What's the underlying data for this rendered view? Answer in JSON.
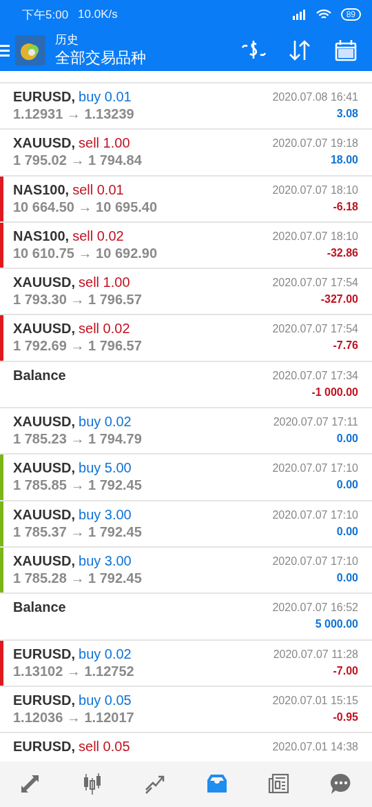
{
  "status_bar": {
    "time": "下午5:00",
    "speed": "10.0K/s",
    "battery": "89"
  },
  "app_bar": {
    "title": "历史",
    "subtitle": "全部交易品种"
  },
  "rows": [
    {
      "kind": "trade",
      "symbol": "EURUSD,",
      "side": "buy",
      "lots": "0.01",
      "prices": "1.12931 → 1.13239",
      "date": "2020.07.08 16:41",
      "profit": "3.08",
      "loss": false
    },
    {
      "kind": "trade",
      "symbol": "XAUUSD,",
      "side": "sell",
      "lots": "1.00",
      "prices": "1 795.02 → 1 794.84",
      "date": "2020.07.07 19:18",
      "profit": "18.00",
      "loss": false
    },
    {
      "kind": "trade",
      "symbol": "NAS100,",
      "side": "sell",
      "lots": "0.01",
      "prices": "10 664.50 → 10 695.40",
      "date": "2020.07.07 18:10",
      "profit": "-6.18",
      "loss": true,
      "color": "#e0191f"
    },
    {
      "kind": "trade",
      "symbol": "NAS100,",
      "side": "sell",
      "lots": "0.02",
      "prices": "10 610.75 → 10 692.90",
      "date": "2020.07.07 18:10",
      "profit": "-32.86",
      "loss": true,
      "color": "#e0191f"
    },
    {
      "kind": "trade",
      "symbol": "XAUUSD,",
      "side": "sell",
      "lots": "1.00",
      "prices": "1 793.30 → 1 796.57",
      "date": "2020.07.07 17:54",
      "profit": "-327.00",
      "loss": true
    },
    {
      "kind": "trade",
      "symbol": "XAUUSD,",
      "side": "sell",
      "lots": "0.02",
      "prices": "1 792.69 → 1 796.57",
      "date": "2020.07.07 17:54",
      "profit": "-7.76",
      "loss": true,
      "color": "#e0191f"
    },
    {
      "kind": "balance",
      "symbol": "Balance",
      "date": "2020.07.07 17:34",
      "profit": "-1 000.00",
      "loss": true
    },
    {
      "kind": "trade",
      "symbol": "XAUUSD,",
      "side": "buy",
      "lots": "0.02",
      "prices": "1 785.23 → 1 794.79",
      "date": "2020.07.07 17:11",
      "profit": "0.00",
      "loss": false
    },
    {
      "kind": "trade",
      "symbol": "XAUUSD,",
      "side": "buy",
      "lots": "5.00",
      "prices": "1 785.85 → 1 792.45",
      "date": "2020.07.07 17:10",
      "profit": "0.00",
      "loss": false,
      "color": "#7cb518"
    },
    {
      "kind": "trade",
      "symbol": "XAUUSD,",
      "side": "buy",
      "lots": "3.00",
      "prices": "1 785.37 → 1 792.45",
      "date": "2020.07.07 17:10",
      "profit": "0.00",
      "loss": false,
      "color": "#7cb518"
    },
    {
      "kind": "trade",
      "symbol": "XAUUSD,",
      "side": "buy",
      "lots": "3.00",
      "prices": "1 785.28 → 1 792.45",
      "date": "2020.07.07 17:10",
      "profit": "0.00",
      "loss": false,
      "color": "#7cb518"
    },
    {
      "kind": "balance",
      "symbol": "Balance",
      "date": "2020.07.07 16:52",
      "profit": "5 000.00",
      "loss": false
    },
    {
      "kind": "trade",
      "symbol": "EURUSD,",
      "side": "buy",
      "lots": "0.02",
      "prices": "1.13102 → 1.12752",
      "date": "2020.07.07 11:28",
      "profit": "-7.00",
      "loss": true,
      "color": "#e0191f"
    },
    {
      "kind": "trade",
      "symbol": "EURUSD,",
      "side": "buy",
      "lots": "0.05",
      "prices": "1.12036 → 1.12017",
      "date": "2020.07.01 15:15",
      "profit": "-0.95",
      "loss": true
    },
    {
      "kind": "trade",
      "symbol": "EURUSD,",
      "side": "sell",
      "lots": "0.05",
      "date": "2020.07.01 14:38"
    }
  ],
  "nav": [
    {
      "selected": false
    },
    {
      "selected": false
    },
    {
      "selected": false
    },
    {
      "selected": true
    },
    {
      "selected": false
    },
    {
      "selected": false
    }
  ]
}
